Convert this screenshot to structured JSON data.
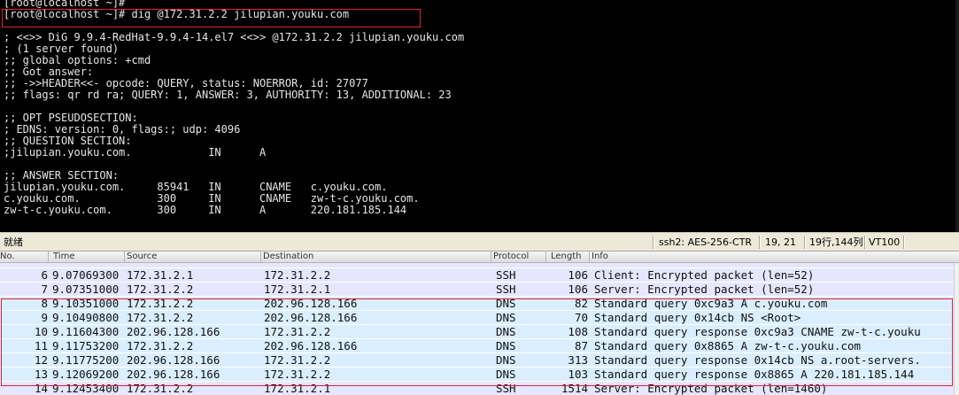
{
  "terminal": {
    "lines": [
      "[root@localhost ~]#",
      "[root@localhost ~]# dig @172.31.2.2 jilupian.youku.com",
      "",
      "; <<>> DiG 9.9.4-RedHat-9.9.4-14.el7 <<>> @172.31.2.2 jilupian.youku.com",
      "; (1 server found)",
      ";; global options: +cmd",
      ";; Got answer:",
      ";; ->>HEADER<<- opcode: QUERY, status: NOERROR, id: 27077",
      ";; flags: qr rd ra; QUERY: 1, ANSWER: 3, AUTHORITY: 13, ADDITIONAL: 23",
      "",
      ";; OPT PSEUDOSECTION:",
      "; EDNS: version: 0, flags:; udp: 4096",
      ";; QUESTION SECTION:",
      ";jilupian.youku.com.            IN      A",
      "",
      ";; ANSWER SECTION:",
      "jilupian.youku.com.     85941   IN      CNAME   c.youku.com.",
      "c.youku.com.            300     IN      CNAME   zw-t-c.youku.com.",
      "zw-t-c.youku.com.       300     IN      A       220.181.185.144"
    ]
  },
  "statusbar": {
    "state": "就绪",
    "connection": "ssh2: AES-256-CTR",
    "cursor": "19, 21",
    "size": "19行,144列",
    "terminal_type": "VT100"
  },
  "packet_list": {
    "columns": [
      "No.",
      "Time",
      "Source",
      "Destination",
      "Protocol",
      "Length",
      "Info"
    ],
    "rows": [
      {
        "no": "6",
        "time": "9.07069300",
        "src": "172.31.2.1",
        "dst": "172.31.2.2",
        "proto": "SSH",
        "len": "106",
        "info": "Client: Encrypted packet (len=52)"
      },
      {
        "no": "7",
        "time": "9.07351000",
        "src": "172.31.2.2",
        "dst": "172.31.2.1",
        "proto": "SSH",
        "len": "106",
        "info": "Server: Encrypted packet (len=52)"
      },
      {
        "no": "8",
        "time": "9.10351000",
        "src": "172.31.2.2",
        "dst": "202.96.128.166",
        "proto": "DNS",
        "len": "82",
        "info": "Standard query 0xc9a3  A c.youku.com"
      },
      {
        "no": "9",
        "time": "9.10490800",
        "src": "172.31.2.2",
        "dst": "202.96.128.166",
        "proto": "DNS",
        "len": "70",
        "info": "Standard query 0x14cb  NS <Root>"
      },
      {
        "no": "10",
        "time": "9.11604300",
        "src": "202.96.128.166",
        "dst": "172.31.2.2",
        "proto": "DNS",
        "len": "108",
        "info": "Standard query response 0xc9a3  CNAME zw-t-c.youku"
      },
      {
        "no": "11",
        "time": "9.11753200",
        "src": "172.31.2.2",
        "dst": "202.96.128.166",
        "proto": "DNS",
        "len": "87",
        "info": "Standard query 0x8865  A zw-t-c.youku.com"
      },
      {
        "no": "12",
        "time": "9.11775200",
        "src": "202.96.128.166",
        "dst": "172.31.2.2",
        "proto": "DNS",
        "len": "313",
        "info": "Standard query response 0x14cb  NS a.root-servers."
      },
      {
        "no": "13",
        "time": "9.12069200",
        "src": "202.96.128.166",
        "dst": "172.31.2.2",
        "proto": "DNS",
        "len": "103",
        "info": "Standard query response 0x8865  A 220.181.185.144"
      },
      {
        "no": "14",
        "time": "9.12453400",
        "src": "172.31.2.2",
        "dst": "172.31.2.1",
        "proto": "SSH",
        "len": "1514",
        "info": "Server: Encrypted packet (len=1460)"
      }
    ]
  },
  "colors": {
    "terminal_bg": "#000000",
    "terminal_fg": "#e6e6e6",
    "highlight_box": "#e0203a",
    "ssh_row": "#e7e6ff",
    "dns_row": "#daeeff"
  }
}
